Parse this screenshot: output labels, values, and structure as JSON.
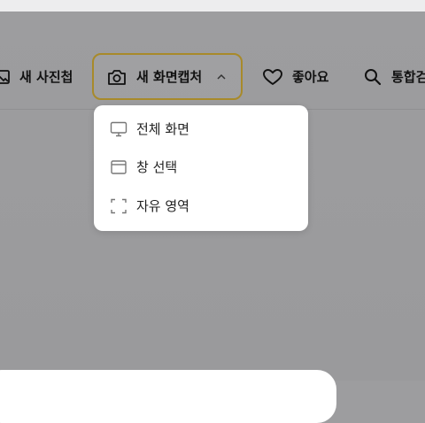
{
  "toolbar": {
    "album_label": "새 사진첩",
    "capture_label": "새 화면캡처",
    "like_label": "좋아요",
    "search_label": "통합검"
  },
  "capture_menu": {
    "items": [
      {
        "label": "전체 화면",
        "icon": "monitor-icon"
      },
      {
        "label": "창 선택",
        "icon": "window-icon"
      },
      {
        "label": "자유 영역",
        "icon": "free-area-icon"
      }
    ]
  },
  "colors": {
    "backdrop": "#9d9d9f",
    "focus_outline": "#a88a2a",
    "menu_bg": "#ffffff"
  }
}
